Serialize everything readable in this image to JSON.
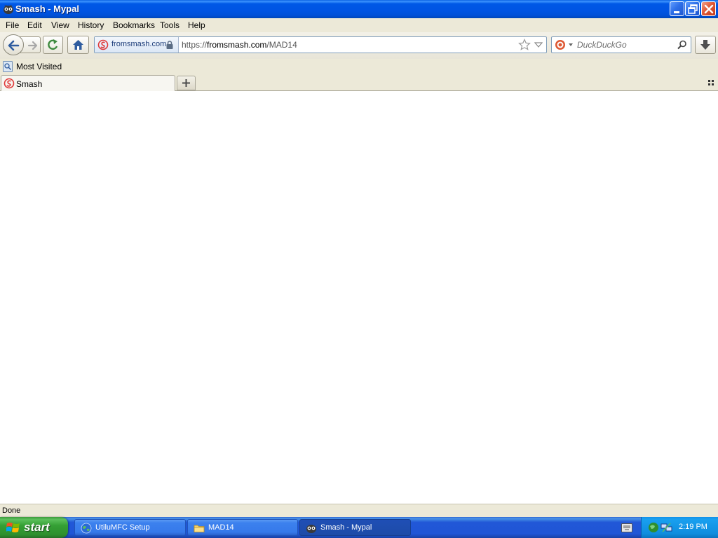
{
  "window": {
    "title": "Smash - Mypal"
  },
  "menubar": {
    "items": [
      "File",
      "Edit",
      "View",
      "History",
      "Bookmarks",
      "Tools",
      "Help"
    ]
  },
  "navbar": {
    "identity_label": "fromsmash.com",
    "url_scheme": "https://",
    "url_host": "fromsmash.com",
    "url_path": "/MAD14",
    "search_placeholder": "DuckDuckGo"
  },
  "bookmarks": {
    "most_visited": "Most Visited"
  },
  "tabs": [
    {
      "label": "Smash",
      "selected": true
    }
  ],
  "statusbar": {
    "text": "Done"
  },
  "taskbar": {
    "start_label": "start",
    "tasks": [
      {
        "label": "UtiluMFC Setup",
        "icon": "globe-icon",
        "active": false
      },
      {
        "label": "MAD14",
        "icon": "folder-icon",
        "active": false
      },
      {
        "label": "Smash - Mypal",
        "icon": "mypal-icon",
        "active": true
      }
    ],
    "clock": "2:19 PM"
  },
  "colors": {
    "titlebar": "#0054E3",
    "taskbar": "#2056D6",
    "start": "#35A035",
    "tray": "#0F8DDE",
    "smash_brand": "#E03A3A",
    "chrome": "#ECE9D8"
  }
}
